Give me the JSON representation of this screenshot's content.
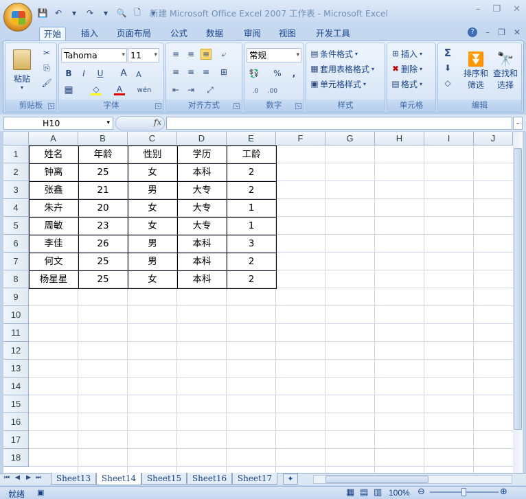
{
  "window": {
    "title": "新建 Microsoft Office Excel 2007 工作表 - Microsoft Excel",
    "minimize": "–",
    "restore": "❐",
    "close": "✕"
  },
  "qat": {
    "save": "💾",
    "undo": "↶",
    "redo": "↷",
    "print_preview": "🔍",
    "new": "🗋",
    "more": "▾"
  },
  "tabs": [
    "开始",
    "插入",
    "页面布局",
    "公式",
    "数据",
    "审阅",
    "视图",
    "开发工具"
  ],
  "tabs_right": {
    "help": "?",
    "min": "–",
    "restore": "❐",
    "close": "✕"
  },
  "ribbon": {
    "clipboard": {
      "label": "剪贴板",
      "paste": "粘贴",
      "cut": "✂",
      "copy": "⎘",
      "format_painter": "🖌"
    },
    "font": {
      "label": "字体",
      "font_name": "Tahoma",
      "font_size": "11",
      "bold": "B",
      "italic": "I",
      "underline": "U",
      "grow": "A",
      "shrink": "A",
      "border": "▦",
      "fill": "◇",
      "color": "A",
      "wen": "wén"
    },
    "alignment": {
      "label": "对齐方式"
    },
    "number": {
      "label": "数字",
      "format": "常规",
      "currency": "💱",
      "percent": "%",
      "comma": ",",
      "inc_decimal": ".0",
      "dec_decimal": ".00"
    },
    "styles": {
      "label": "样式",
      "conditional": "条件格式",
      "table": "套用表格格式",
      "cell_styles": "单元格样式"
    },
    "cells": {
      "label": "单元格",
      "insert": "插入",
      "delete": "删除",
      "format": "格式"
    },
    "editing": {
      "label": "编辑",
      "sum": "Σ",
      "fill": "⬇",
      "clear": "◇",
      "sort_filter_1": "排序和",
      "sort_filter_2": "筛选",
      "find_select_1": "查找和",
      "find_select_2": "选择"
    }
  },
  "formula_bar": {
    "name_box": "H10",
    "fx": "fx",
    "value": ""
  },
  "columns": [
    "A",
    "B",
    "C",
    "D",
    "E",
    "F",
    "G",
    "H",
    "I",
    "J"
  ],
  "rows": [
    "1",
    "2",
    "3",
    "4",
    "5",
    "6",
    "7",
    "8",
    "9",
    "10",
    "11",
    "12",
    "13",
    "14",
    "15",
    "16",
    "17",
    "18"
  ],
  "table": {
    "headers": [
      "姓名",
      "年龄",
      "性别",
      "学历",
      "工龄"
    ],
    "rows": [
      [
        "钟离",
        "25",
        "女",
        "本科",
        "2"
      ],
      [
        "张鑫",
        "21",
        "男",
        "大专",
        "2"
      ],
      [
        "朱卉",
        "20",
        "女",
        "大专",
        "1"
      ],
      [
        "周敏",
        "23",
        "女",
        "大专",
        "1"
      ],
      [
        "李佳",
        "26",
        "男",
        "本科",
        "3"
      ],
      [
        "何文",
        "25",
        "男",
        "本科",
        "2"
      ],
      [
        "杨星星",
        "25",
        "女",
        "本科",
        "2"
      ]
    ]
  },
  "sheets": [
    "Sheet13",
    "Sheet14",
    "Sheet15",
    "Sheet16",
    "Sheet17"
  ],
  "active_sheet": "Sheet14",
  "status": {
    "ready": "就绪",
    "zoom": "100%"
  }
}
